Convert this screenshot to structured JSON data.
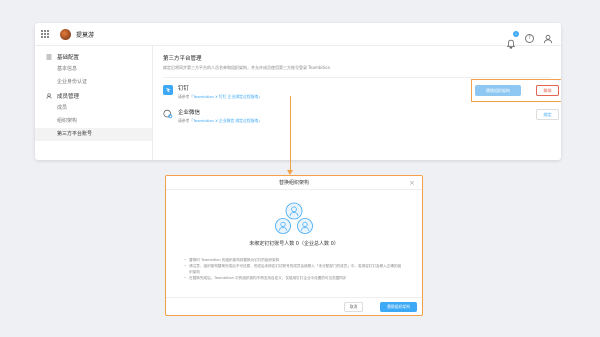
{
  "header": {
    "org_name": "提莫游"
  },
  "notifications": {
    "count": "1"
  },
  "sidebar": {
    "groups": [
      {
        "label": "基础配置",
        "items": [
          "基本信息",
          "企业身份认证"
        ]
      },
      {
        "label": "成员管理",
        "items": [
          "成员",
          "组织架构",
          "第三方平台账号"
        ]
      }
    ],
    "active": "第三方平台账号"
  },
  "main": {
    "title": "第三方平台管理",
    "desc": "绑定后将同步第三方平台的人员名单和组织架构，并允许成员使用第三方账号登录 Teambition",
    "platforms": [
      {
        "name": "钉钉",
        "sub_prefix": "请参考",
        "sub_link": "「Teambition X 钉钉 企业绑定过程指南」",
        "primary": "替换组织架构",
        "secondary": "解绑"
      },
      {
        "name": "企业微信",
        "sub_prefix": "请参考",
        "sub_link": "「Teambition X 企业微信 绑定过程指南」",
        "secondary": "绑定"
      }
    ]
  },
  "dialog": {
    "title": "替换组织架构",
    "headline": "未绑定钉钉账号人数 0（企业总人数 0）",
    "bullets": [
      "替换时 Teambition 的组织架构将替换为钉钉的组织架构",
      "请注意，组织架构替换完成后不可还原，完成后未绑定钉钉账号的成员会被移入「未分配部门的成员」中，若绑定钉钉会移入正确的组织架构",
      "在替换完成后，Teambition 中的组织架构不再支持自定义，仅能用钉钉企业中设置的可见范围同步"
    ],
    "cancel": "取消",
    "confirm": "替换组织架构"
  },
  "colors": {
    "accent": "#3da8f5",
    "highlight": "#f2a14a",
    "danger": "#e86452"
  }
}
